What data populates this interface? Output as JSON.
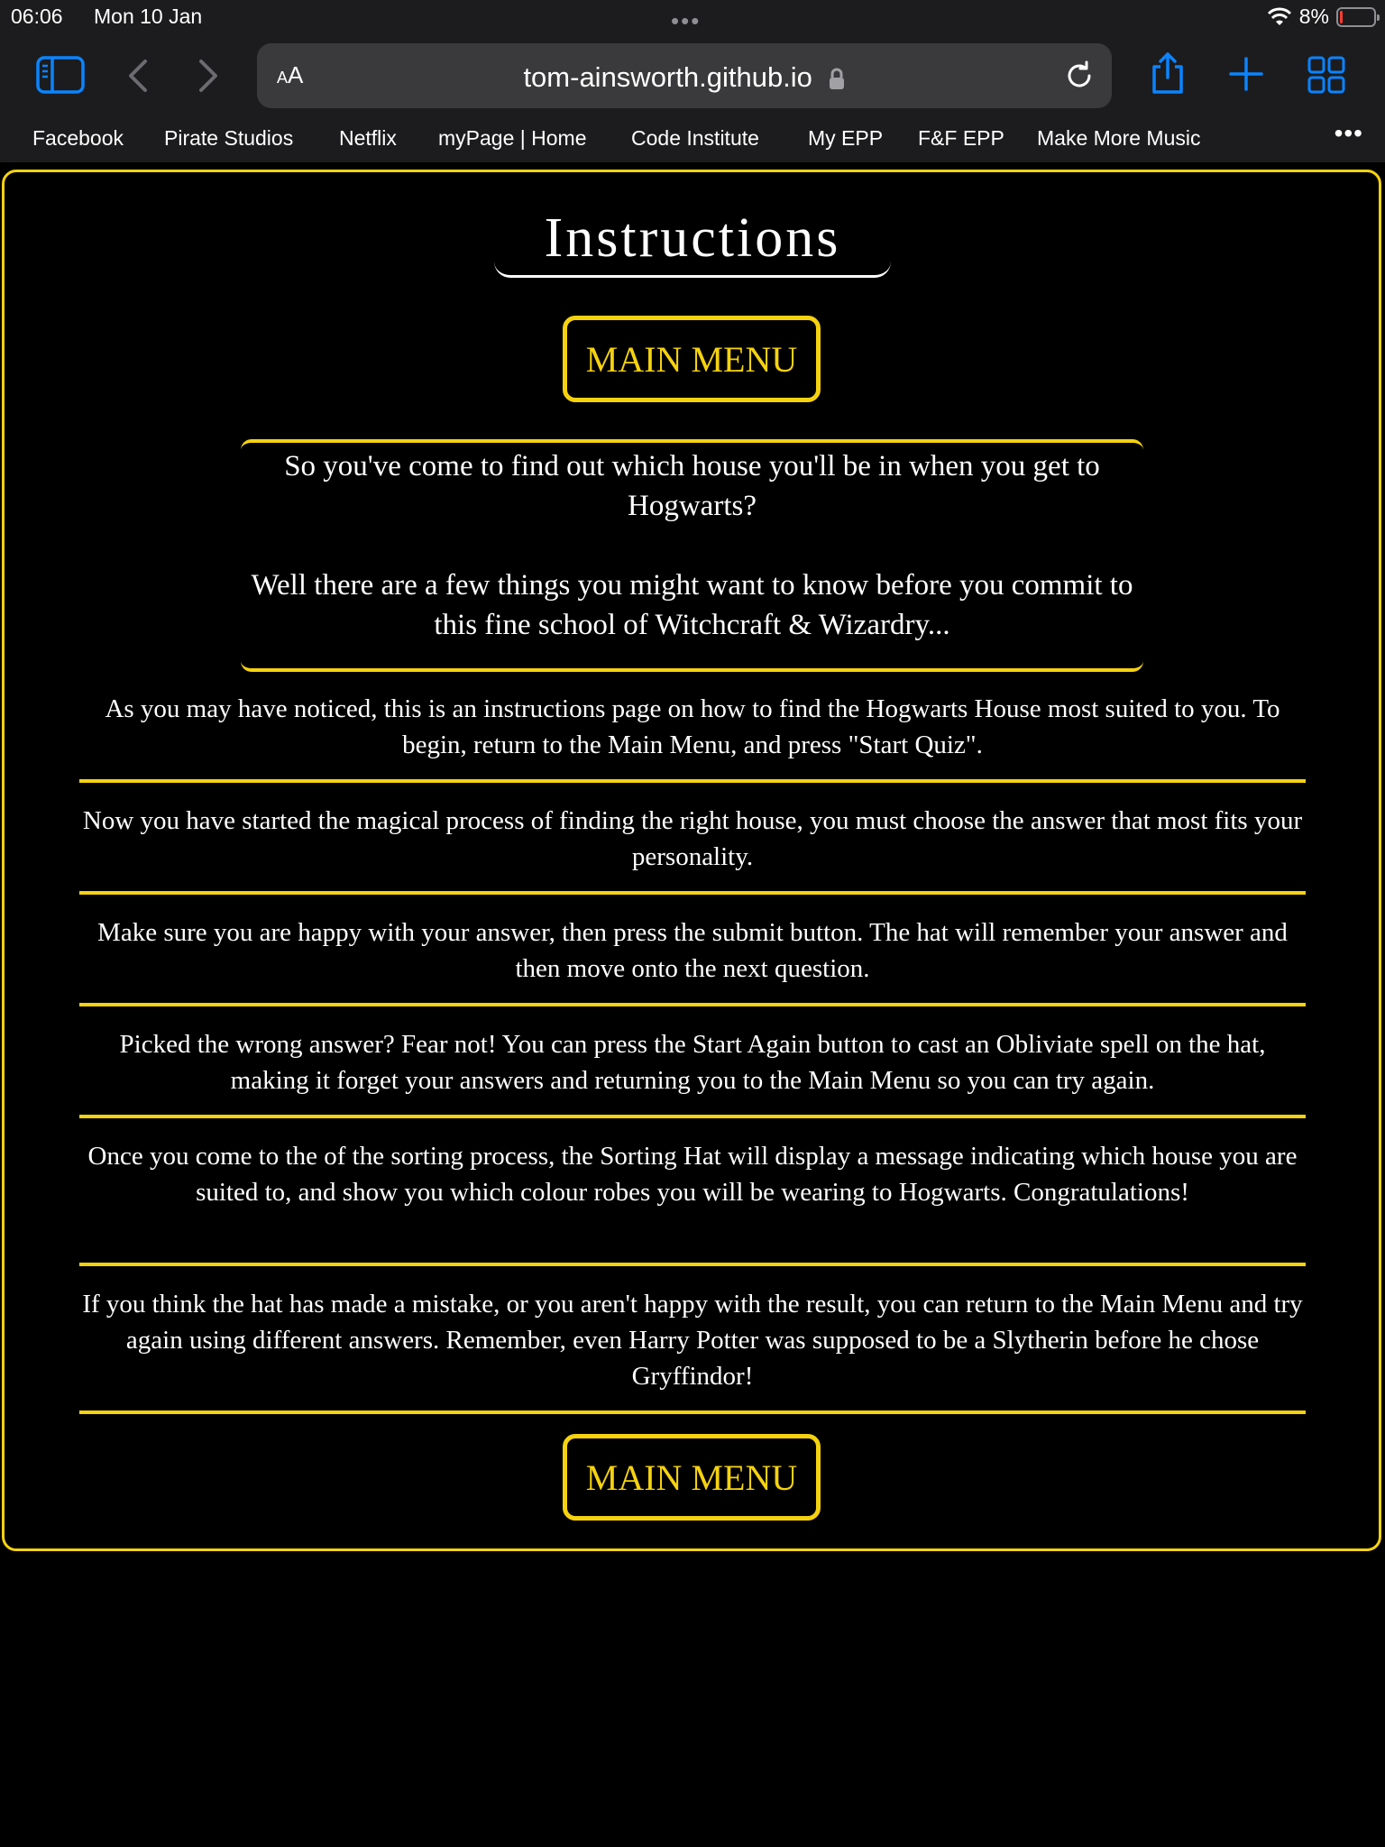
{
  "status_bar": {
    "time": "06:06",
    "date": "Mon 10 Jan",
    "battery": "8%",
    "battery_level": 0.08
  },
  "browser": {
    "url": "tom-ainsworth.github.io",
    "text_size_label_small": "A",
    "text_size_label_large": "A",
    "bookmarks": [
      "Facebook",
      "Pirate Studios",
      "Netflix",
      "myPage | Home",
      "Code Institute",
      "My EPP",
      "F&F EPP",
      "Make More Music"
    ]
  },
  "page": {
    "title": "Instructions",
    "main_menu_label": "MAIN MENU",
    "intro": [
      "So you've come to find out which house you'll be in when you get to Hogwarts?",
      "Well there are a few things you might want to know before you commit to this fine school of Witchcraft & Wizardry..."
    ],
    "steps": [
      "As you may have noticed, this is an instructions page on how to find the Hogwarts House most suited to you. To begin, return to the Main Menu, and press \"Start Quiz\".",
      "Now you have started the magical process of finding the right house, you must choose the answer that most fits your personality.",
      "Make sure you are happy with your answer, then press the submit button. The hat will remember your answer and then move onto the next question.",
      "Picked the wrong answer? Fear not! You can press the Start Again button to cast an Obliviate spell on the hat, making it forget your answers and returning you to the Main Menu so you can try again.",
      "Once you come to the of the sorting process, the Sorting Hat will display a message indicating which house you are suited to, and show you which colour robes you will be wearing to Hogwarts. Congratulations!",
      "If you think the hat has made a mistake, or you aren't happy with the result, you can return to the Main Menu and try again using different answers. Remember, even Harry Potter was supposed to be a Slytherin before he chose Gryffindor!"
    ]
  },
  "colors": {
    "accent": "#f5d20e",
    "background": "#000000",
    "browser_chrome": "#1c1c1e",
    "ios_blue": "#0a84ff"
  },
  "icons": [
    "sidebar-icon",
    "back-icon",
    "forward-icon",
    "lock-icon",
    "reload-icon",
    "share-icon",
    "new-tab-icon",
    "tabs-icon",
    "more-icon"
  ]
}
